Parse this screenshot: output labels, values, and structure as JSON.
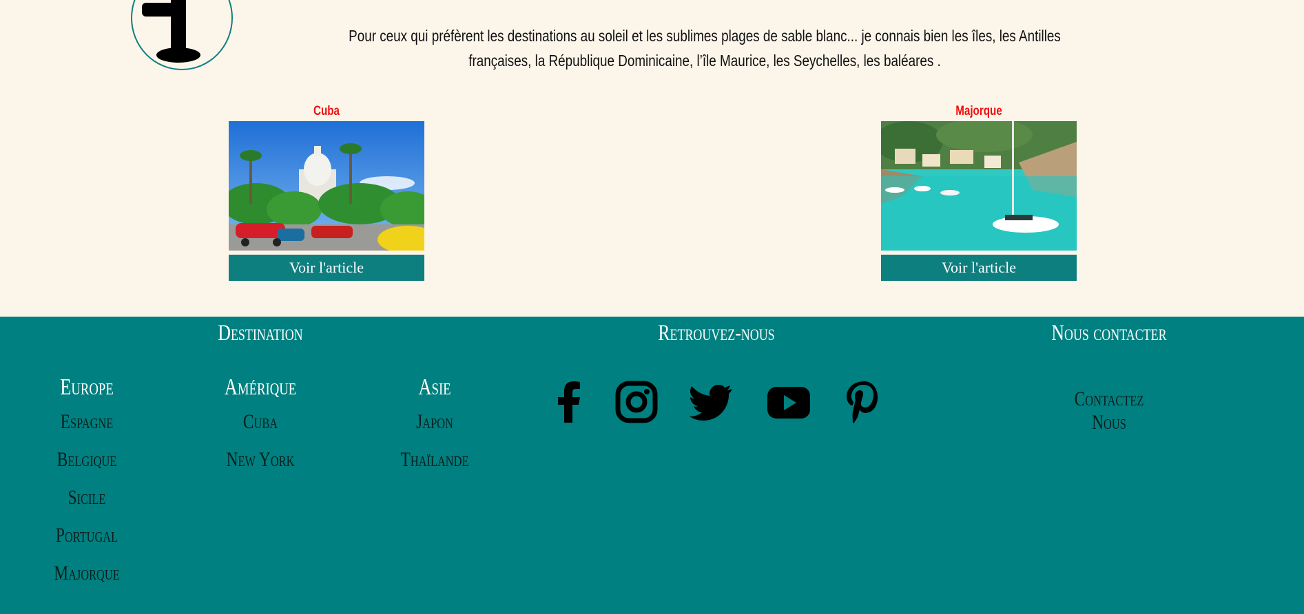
{
  "intro": {
    "text": "Pour ceux qui préfèrent les destinations au soleil et les sublimes plages de sable blanc... je connais bien les îles, les Antilles françaises, la République Dominicaine, l’île Maurice, les Seychelles, les baléares ."
  },
  "cards": [
    {
      "title": "Cuba",
      "button": "Voir l'article"
    },
    {
      "title": "Majorque",
      "button": "Voir l'article"
    }
  ],
  "footer": {
    "destination_heading": "Destination",
    "social_heading": "Retrouvez-nous",
    "contact_heading": "Nous contacter",
    "contact_link": "Contactez Nous",
    "columns": [
      {
        "title": "Europe",
        "items": [
          "Espagne",
          "Belgique",
          "Sicile",
          "Portugal",
          "Majorque"
        ]
      },
      {
        "title": "Amérique",
        "items": [
          "Cuba",
          "New York"
        ]
      },
      {
        "title": "Asie",
        "items": [
          "Japon",
          "Thaïlande"
        ]
      }
    ],
    "social_icons": [
      "facebook-icon",
      "instagram-icon",
      "twitter-icon",
      "youtube-icon",
      "pinterest-icon"
    ]
  },
  "colors": {
    "background": "#fcf5ea",
    "teal": "#008080",
    "button": "#0e7f7f",
    "card_title": "#ee1111"
  }
}
